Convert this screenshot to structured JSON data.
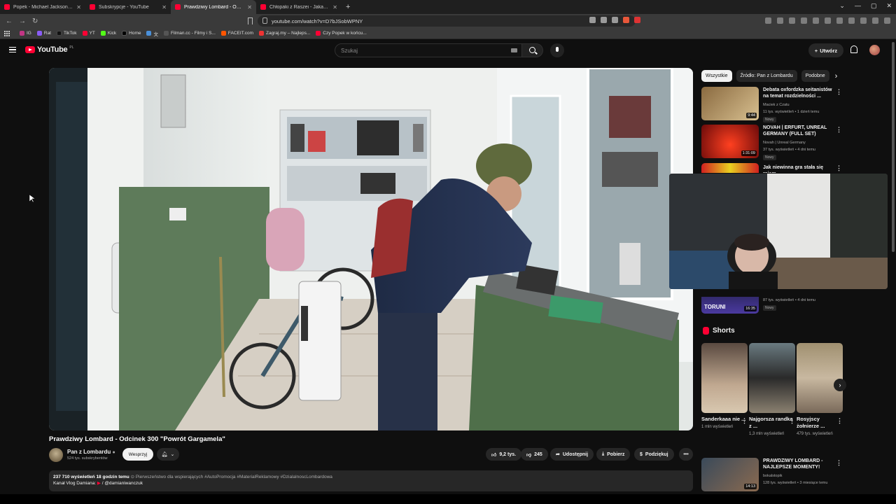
{
  "browser": {
    "tabs": [
      {
        "title": "Popek - Michael Jackson po odwyku",
        "active": false
      },
      {
        "title": "Subskrypcje - YouTube",
        "active": false
      },
      {
        "title": "Prawdziwy Lombard - Odcinek",
        "active": true
      },
      {
        "title": "Chłopaki z Raszei - Jaka to melodia",
        "active": false
      }
    ],
    "new_tab": "+",
    "url": "youtube.com/watch?v=D7bJSobWPNY",
    "bookmarks": [
      "IG",
      "Rat",
      "TikTok",
      "YT",
      "Kick",
      "Home",
      "文",
      "Filman.cc - Filmy i S...",
      "FACEIT.com",
      "Zagraj.my – Najleps...",
      "Czy Popek w końcu..."
    ]
  },
  "youtube": {
    "logo": "YouTube",
    "country": "PL",
    "search_placeholder": "Szukaj",
    "create_label": "Utwórz"
  },
  "video": {
    "title": "Prawdziwy Lombard - Odcinek 300 \"Powrót Gargamela\"",
    "channel": "Pan z Lombardu",
    "subscribers": "524 tys. subskrybentów",
    "support_label": "Wesprzyj",
    "likes": "9,2 tys.",
    "dislikes": "245",
    "share_label": "Udostępnij",
    "download_label": "Pobierz",
    "thanks_label": "Podziękuj",
    "more_label": "•••",
    "views": "237 710 wyświetleń",
    "age": "18 godzin temu",
    "priority": "Pierwszeństwo dla wspierających",
    "tags": "#AutoPromocja #MaterialReklamowy #DzialalnoscLombardowa",
    "desc_line2_label": "Kanał Vlog Damiana:",
    "desc_line2_link": "/ @damianiwanczuk"
  },
  "filters": [
    "Wszystkie",
    "Źródło: Pan z Lombardu",
    "Podobne"
  ],
  "recommendations": [
    {
      "title": "Debata oxfordzka seitanistów na temat rozdzielności ...",
      "channel": "Maciek z Czatu",
      "meta": "11 tys. wyświetleń • 1 dzień temu",
      "badge": "Nowy",
      "duration": "9:44"
    },
    {
      "title": "NOVAH | ERFURT, UNREAL GERMANY (FULL SET)",
      "channel": "Novah | Unreal Germany",
      "meta": "37 tys. wyświetleń • 4 dni temu",
      "badge": "Nowy",
      "duration": "1:31:09"
    },
    {
      "title": "Jak niewinna gra stała się rajem",
      "channel": "",
      "meta": "",
      "badge": "",
      "duration": ""
    },
    {
      "title": "",
      "channel": "",
      "meta": "87 tys. wyświetleń • 4 dni temu",
      "badge": "Nowy",
      "duration": "16:35",
      "thumb_text": "TORUNI"
    }
  ],
  "shorts": {
    "heading": "Shorts",
    "items": [
      {
        "title": "Sanderkaaa nie ...",
        "views": "1 mln wyświetleń"
      },
      {
        "title": "Najgorsza randka z ...",
        "views": "1,3 mln wyświetleń"
      },
      {
        "title": "Rosyjscy żołnierze ...",
        "views": "479 tys. wyświetleń"
      }
    ]
  },
  "bottom_rec": {
    "title": "PRAWDZIWY LOMBARD - NAJLEPSZE MOMENTY!",
    "channel": "bokalstopik",
    "meta": "128 tys. wyświetleń • 3 miesiące temu",
    "duration": "14:13"
  },
  "colors": {
    "accent": "#ff0033",
    "bg": "#0f0f0f"
  }
}
